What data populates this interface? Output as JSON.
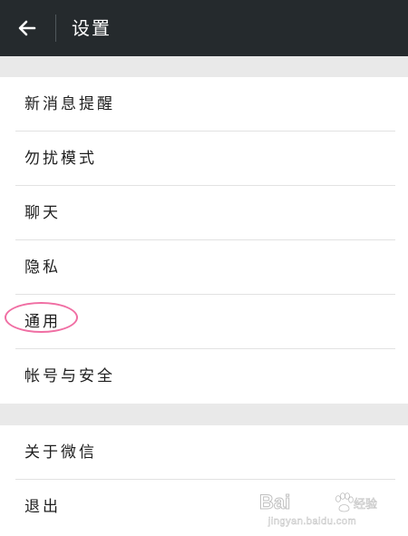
{
  "appbar": {
    "title": "设置",
    "back_icon": "arrow-left-icon"
  },
  "groups": [
    {
      "items": [
        {
          "label": "新消息提醒"
        },
        {
          "label": "勿扰模式"
        },
        {
          "label": "聊天"
        },
        {
          "label": "隐私"
        },
        {
          "label": "通用"
        },
        {
          "label": "帐号与安全"
        }
      ]
    },
    {
      "items": [
        {
          "label": "关于微信"
        },
        {
          "label": "退出"
        }
      ]
    }
  ],
  "annotation": {
    "highlighted_item": "通用",
    "color": "#f06ea3"
  },
  "watermark": {
    "brand": "Bai",
    "brand_cn": "经验",
    "url": "jingyan.baidu.com"
  },
  "colors": {
    "appbar_bg": "#252a2d",
    "page_bg": "#e9e9e9",
    "divider": "#e2e2e2"
  }
}
